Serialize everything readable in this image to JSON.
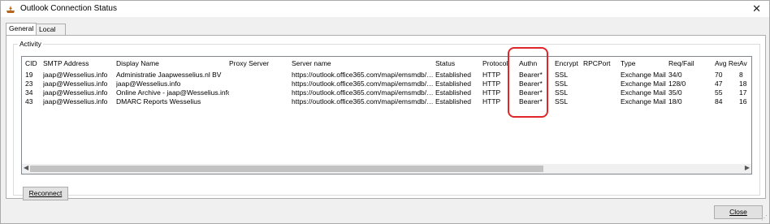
{
  "window": {
    "title": "Outlook Connection Status",
    "close_icon": "close-icon"
  },
  "tabs": [
    {
      "label": "General",
      "active": true
    },
    {
      "label": "Local Mailbox",
      "active": false
    }
  ],
  "activity": {
    "label": "Activity",
    "columns": [
      "CID",
      "SMTP Address",
      "Display Name",
      "Proxy Server",
      "Server name",
      "Status",
      "Protocol",
      "Authn",
      "Encrypt",
      "RPCPort",
      "Type",
      "Req/Fail",
      "Avg Resp",
      "Av"
    ],
    "rows": [
      [
        "19",
        "jaap@Wesselius.info",
        "Administratie Jaapwesselius.nl BV",
        "",
        "https://outlook.office365.com/mapi/emsmdb/…",
        "Established",
        "HTTP",
        "Bearer*",
        "SSL",
        "",
        "Exchange Mail",
        "34/0",
        "70",
        "8"
      ],
      [
        "23",
        "jaap@Wesselius.info",
        "jaap@Wesselius.info",
        "",
        "https://outlook.office365.com/mapi/emsmdb/…",
        "Established",
        "HTTP",
        "Bearer*",
        "SSL",
        "",
        "Exchange Mail",
        "128/0",
        "47",
        "18"
      ],
      [
        "34",
        "jaap@Wesselius.info",
        "Online Archive - jaap@Wesselius.info",
        "",
        "https://outlook.office365.com/mapi/emsmdb/…",
        "Established",
        "HTTP",
        "Bearer*",
        "SSL",
        "",
        "Exchange Mail",
        "35/0",
        "55",
        "17"
      ],
      [
        "43",
        "jaap@Wesselius.info",
        "DMARC Reports Wesselius",
        "",
        "https://outlook.office365.com/mapi/emsmdb/…",
        "Established",
        "HTTP",
        "Bearer*",
        "SSL",
        "",
        "Exchange Mail",
        "18/0",
        "84",
        "16"
      ]
    ]
  },
  "buttons": {
    "reconnect": "Reconnect",
    "close": "Close"
  },
  "colors": {
    "highlight": "#e0262a"
  }
}
